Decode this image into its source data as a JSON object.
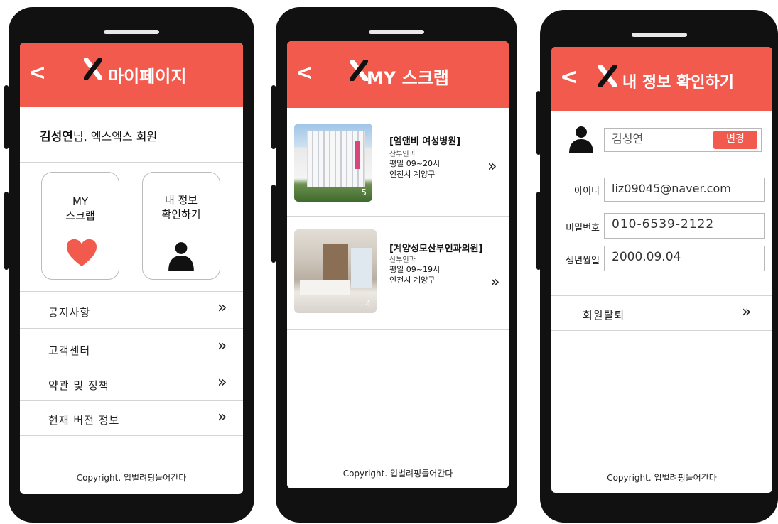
{
  "colors": {
    "accent": "#f25a4e",
    "frame": "#111111"
  },
  "screen1": {
    "back": "<",
    "title": "마이페이지",
    "user_name": "김성연",
    "user_suffix": "님, 엑스엑스 회원",
    "card_scrap": {
      "line1": "MY",
      "line2": "스크랩",
      "icon": "heart-icon"
    },
    "card_info": {
      "line1": "내 정보",
      "line2": "확인하기",
      "icon": "person-icon"
    },
    "menu": [
      {
        "label": "공지사항"
      },
      {
        "label": "고객센터"
      },
      {
        "label": "약관 및 정책"
      },
      {
        "label": "현재 버전 정보"
      }
    ],
    "chevron": "»",
    "copyright": "Copyright. 입벌려핑들어간다"
  },
  "screen2": {
    "back": "<",
    "title": "MY 스크랩",
    "items": [
      {
        "name": "[엠앤비 여성병원]",
        "dept": "산부인과",
        "hours": "평일 09~20시",
        "location": "인천시 계양구",
        "photo_count": "5"
      },
      {
        "name": "[계양성모산부인과의원]",
        "dept": "산부인과",
        "hours": "평일 09~19시",
        "location": "인천시 계양구",
        "photo_count": "4"
      }
    ],
    "chevron": "»",
    "copyright": "Copyright. 입벌려핑들어간다"
  },
  "screen3": {
    "back": "<",
    "title": "내 정보 확인하기",
    "name_value": "김성연",
    "edit_label": "변경",
    "fields": [
      {
        "label": "아이디",
        "value": "liz09045@naver.com"
      },
      {
        "label": "비밀번호",
        "value": "010-6539-2122"
      },
      {
        "label": "생년월일",
        "value": "2000.09.04"
      }
    ],
    "withdraw": "회원탈퇴",
    "chevron": "»",
    "copyright": "Copyright. 입벌려핑들어간다"
  }
}
